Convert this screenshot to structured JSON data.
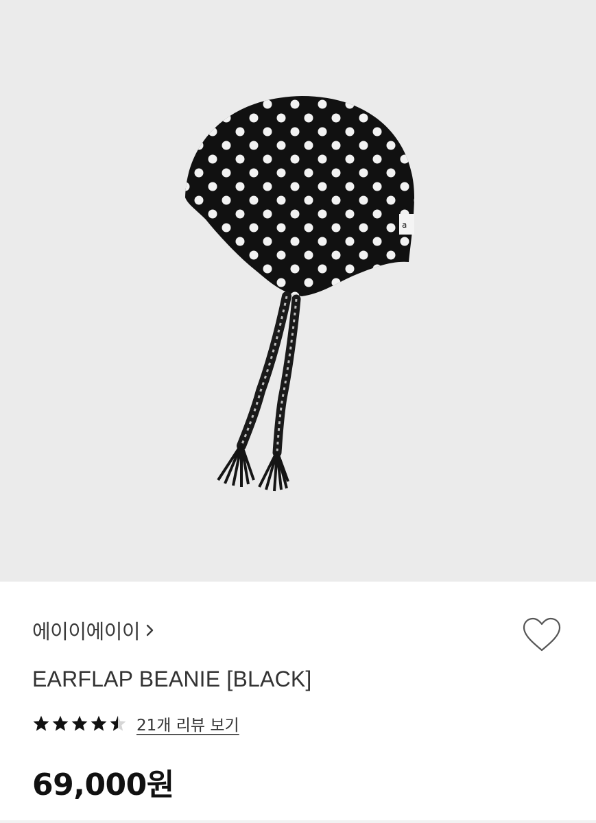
{
  "product": {
    "brand": "에이이에이이",
    "title": "EARFLAP BEANIE [BLACK]",
    "rating": 4.5,
    "review_link": "21개 리뷰 보기",
    "price": "69,000원",
    "image_icon": "beanie-image"
  },
  "icons": {
    "brand_chevron": "chevron-right-icon",
    "wishlist": "heart-outline-icon",
    "star": "star-icon"
  },
  "colors": {
    "image_background": "#ebebeb",
    "text_primary": "#333333",
    "price": "#111111",
    "star": "#111111"
  }
}
